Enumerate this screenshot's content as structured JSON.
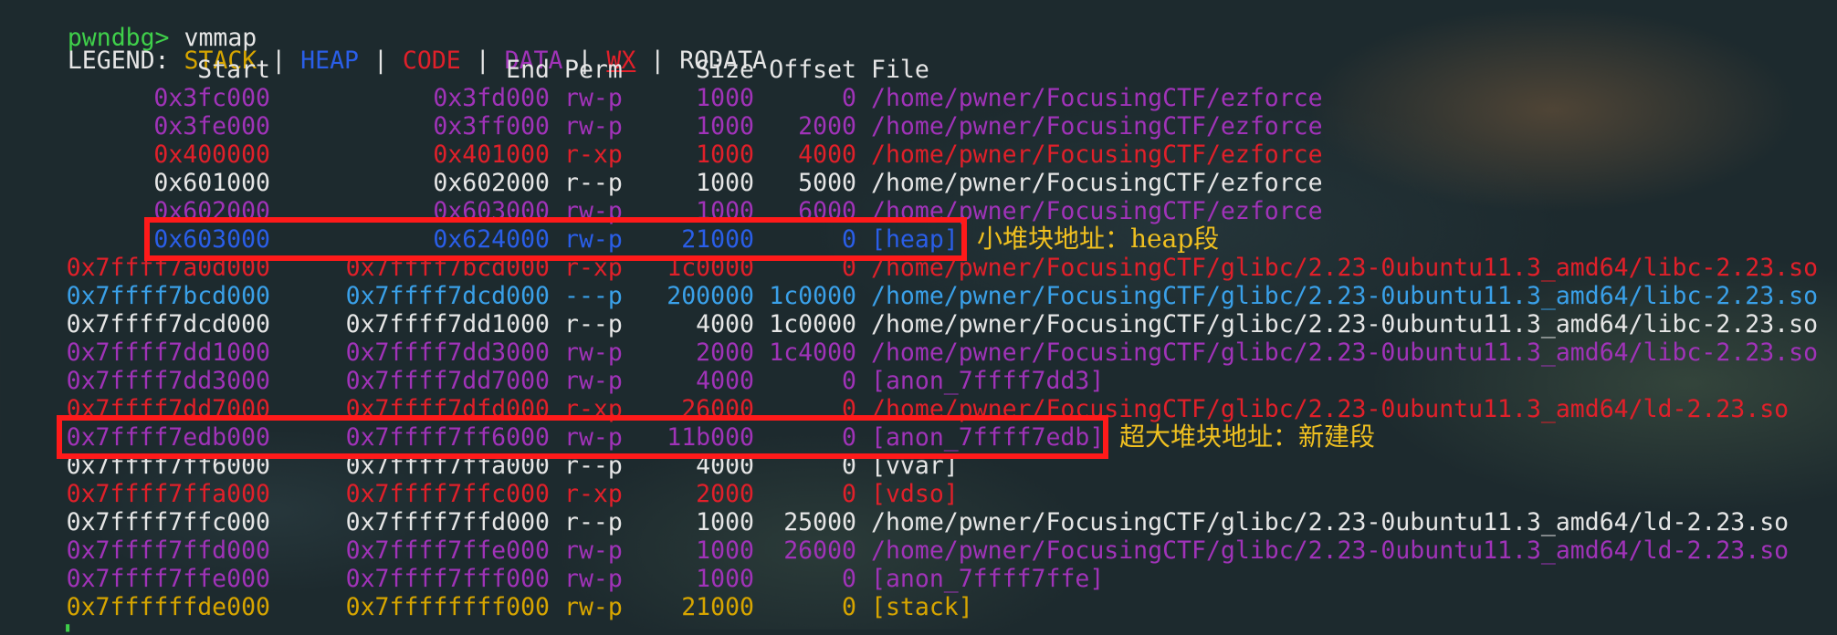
{
  "prompt": {
    "name": "pwndbg>",
    "command": "vmmap"
  },
  "legend": {
    "label": "LEGEND:",
    "items": [
      {
        "text": "STACK",
        "color": "#d7a500"
      },
      {
        "text": "HEAP",
        "color": "#2a5ee8"
      },
      {
        "text": "CODE",
        "color": "#e0202a"
      },
      {
        "text": "DATA",
        "color": "#a033b8"
      },
      {
        "text": "WX",
        "color": "#e0202a",
        "underline": true
      },
      {
        "text": "RODATA",
        "color": "#e6e6e6"
      }
    ],
    "separator": "|"
  },
  "headers": {
    "start": "Start",
    "end": "End",
    "perm": "Perm",
    "size": "Size",
    "offset": "Offset",
    "file": "File"
  },
  "rows": [
    {
      "start": "0x3fc000",
      "end": "0x3fd000",
      "perm": "rw-p",
      "size": "1000",
      "offset": "0",
      "file": "/home/pwner/FocusingCTF/ezforce",
      "color": "#a033b8"
    },
    {
      "start": "0x3fe000",
      "end": "0x3ff000",
      "perm": "rw-p",
      "size": "1000",
      "offset": "2000",
      "file": "/home/pwner/FocusingCTF/ezforce",
      "color": "#a033b8"
    },
    {
      "start": "0x400000",
      "end": "0x401000",
      "perm": "r-xp",
      "size": "1000",
      "offset": "4000",
      "file": "/home/pwner/FocusingCTF/ezforce",
      "color": "#e0202a"
    },
    {
      "start": "0x601000",
      "end": "0x602000",
      "perm": "r--p",
      "size": "1000",
      "offset": "5000",
      "file": "/home/pwner/FocusingCTF/ezforce",
      "color": "#e6e6e6"
    },
    {
      "start": "0x602000",
      "end": "0x603000",
      "perm": "rw-p",
      "size": "1000",
      "offset": "6000",
      "file": "/home/pwner/FocusingCTF/ezforce",
      "color": "#a033b8"
    },
    {
      "start": "0x603000",
      "end": "0x624000",
      "perm": "rw-p",
      "size": "21000",
      "offset": "0",
      "file": "[heap]",
      "color": "#2a5ee8"
    },
    {
      "start": "0x7ffff7a0d000",
      "end": "0x7ffff7bcd000",
      "perm": "r-xp",
      "size": "1c0000",
      "offset": "0",
      "file": "/home/pwner/FocusingCTF/glibc/2.23-0ubuntu11.3_amd64/libc-2.23.so",
      "color": "#e0202a"
    },
    {
      "start": "0x7ffff7bcd000",
      "end": "0x7ffff7dcd000",
      "perm": "---p",
      "size": "200000",
      "offset": "1c0000",
      "file": "/home/pwner/FocusingCTF/glibc/2.23-0ubuntu11.3_amd64/libc-2.23.so",
      "color": "#3aa0e8"
    },
    {
      "start": "0x7ffff7dcd000",
      "end": "0x7ffff7dd1000",
      "perm": "r--p",
      "size": "4000",
      "offset": "1c0000",
      "file": "/home/pwner/FocusingCTF/glibc/2.23-0ubuntu11.3_amd64/libc-2.23.so",
      "color": "#e6e6e6"
    },
    {
      "start": "0x7ffff7dd1000",
      "end": "0x7ffff7dd3000",
      "perm": "rw-p",
      "size": "2000",
      "offset": "1c4000",
      "file": "/home/pwner/FocusingCTF/glibc/2.23-0ubuntu11.3_amd64/libc-2.23.so",
      "color": "#a033b8"
    },
    {
      "start": "0x7ffff7dd3000",
      "end": "0x7ffff7dd7000",
      "perm": "rw-p",
      "size": "4000",
      "offset": "0",
      "file": "[anon_7ffff7dd3]",
      "color": "#a033b8"
    },
    {
      "start": "0x7ffff7dd7000",
      "end": "0x7ffff7dfd000",
      "perm": "r-xp",
      "size": "26000",
      "offset": "0",
      "file": "/home/pwner/FocusingCTF/glibc/2.23-0ubuntu11.3_amd64/ld-2.23.so",
      "color": "#e0202a"
    },
    {
      "start": "0x7ffff7edb000",
      "end": "0x7ffff7ff6000",
      "perm": "rw-p",
      "size": "11b000",
      "offset": "0",
      "file": "[anon_7ffff7edb]",
      "color": "#a033b8"
    },
    {
      "start": "0x7ffff7ff6000",
      "end": "0x7ffff7ffa000",
      "perm": "r--p",
      "size": "4000",
      "offset": "0",
      "file": "[vvar]",
      "color": "#e6e6e6"
    },
    {
      "start": "0x7ffff7ffa000",
      "end": "0x7ffff7ffc000",
      "perm": "r-xp",
      "size": "2000",
      "offset": "0",
      "file": "[vdso]",
      "color": "#e0202a"
    },
    {
      "start": "0x7ffff7ffc000",
      "end": "0x7ffff7ffd000",
      "perm": "r--p",
      "size": "1000",
      "offset": "25000",
      "file": "/home/pwner/FocusingCTF/glibc/2.23-0ubuntu11.3_amd64/ld-2.23.so",
      "color": "#e6e6e6"
    },
    {
      "start": "0x7ffff7ffd000",
      "end": "0x7ffff7ffe000",
      "perm": "rw-p",
      "size": "1000",
      "offset": "26000",
      "file": "/home/pwner/FocusingCTF/glibc/2.23-0ubuntu11.3_amd64/ld-2.23.so",
      "color": "#a033b8"
    },
    {
      "start": "0x7ffff7ffe000",
      "end": "0x7ffff7fff000",
      "perm": "rw-p",
      "size": "1000",
      "offset": "0",
      "file": "[anon_7ffff7ffe]",
      "color": "#a033b8"
    },
    {
      "start": "0x7ffffffde000",
      "end": "0x7ffffffff000",
      "perm": "rw-p",
      "size": "21000",
      "offset": "0",
      "file": "[stack]",
      "color": "#d7a500"
    }
  ],
  "annotations": {
    "heap_note": "小堆块地址：heap段",
    "anon_note": "超大堆块地址：新建段"
  },
  "colors": {
    "highlight_border": "#ff1a1a",
    "annotation_text": "#f0c020"
  }
}
